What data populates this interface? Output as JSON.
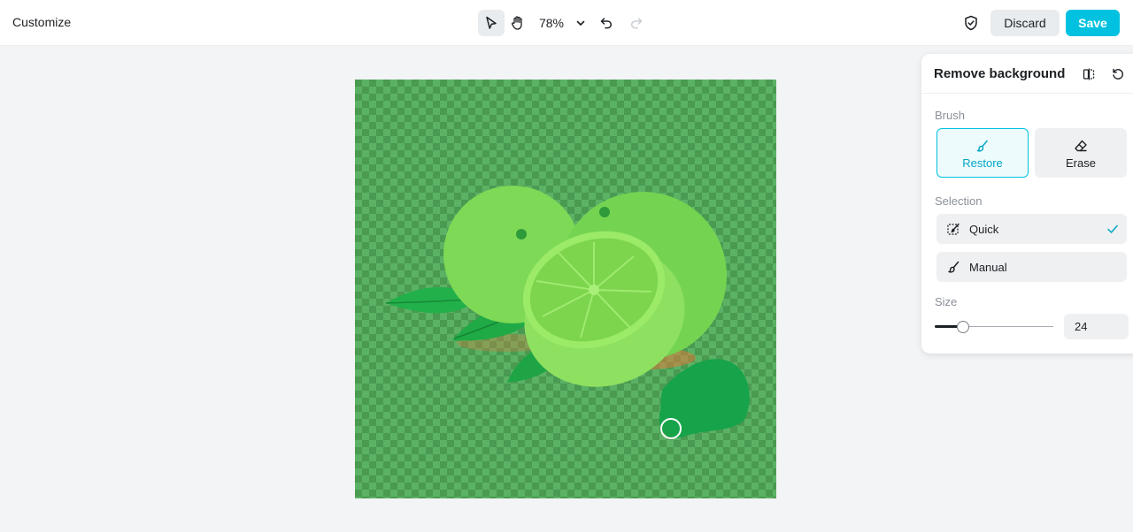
{
  "app": {
    "title": "Customize"
  },
  "toolbar": {
    "select_tool_icon": "cursor-arrow-icon",
    "hand_tool_icon": "hand-icon",
    "zoom_label": "78%",
    "zoom_dropdown_icon": "chevron-down-icon",
    "undo_icon": "undo-icon",
    "redo_icon": "redo-icon"
  },
  "actions": {
    "shield_icon": "shield-check-icon",
    "discard_label": "Discard",
    "save_label": "Save"
  },
  "colors": {
    "accent": "#00c2e0",
    "canvas_tint": "#4a9a52",
    "brush_mark": "#16a34a"
  },
  "panel": {
    "title": "Remove background",
    "compare_icon": "compare-icon",
    "reset_icon": "reset-icon",
    "brush": {
      "label": "Brush",
      "options": [
        {
          "label": "Restore",
          "icon": "brush-icon",
          "selected": true
        },
        {
          "label": "Erase",
          "icon": "eraser-icon",
          "selected": false
        }
      ]
    },
    "selection": {
      "label": "Selection",
      "options": [
        {
          "label": "Quick",
          "icon": "quick-select-icon",
          "selected": true
        },
        {
          "label": "Manual",
          "icon": "manual-brush-icon",
          "selected": false
        }
      ]
    },
    "size": {
      "label": "Size",
      "value": "24",
      "slider_fraction": 0.24
    }
  }
}
